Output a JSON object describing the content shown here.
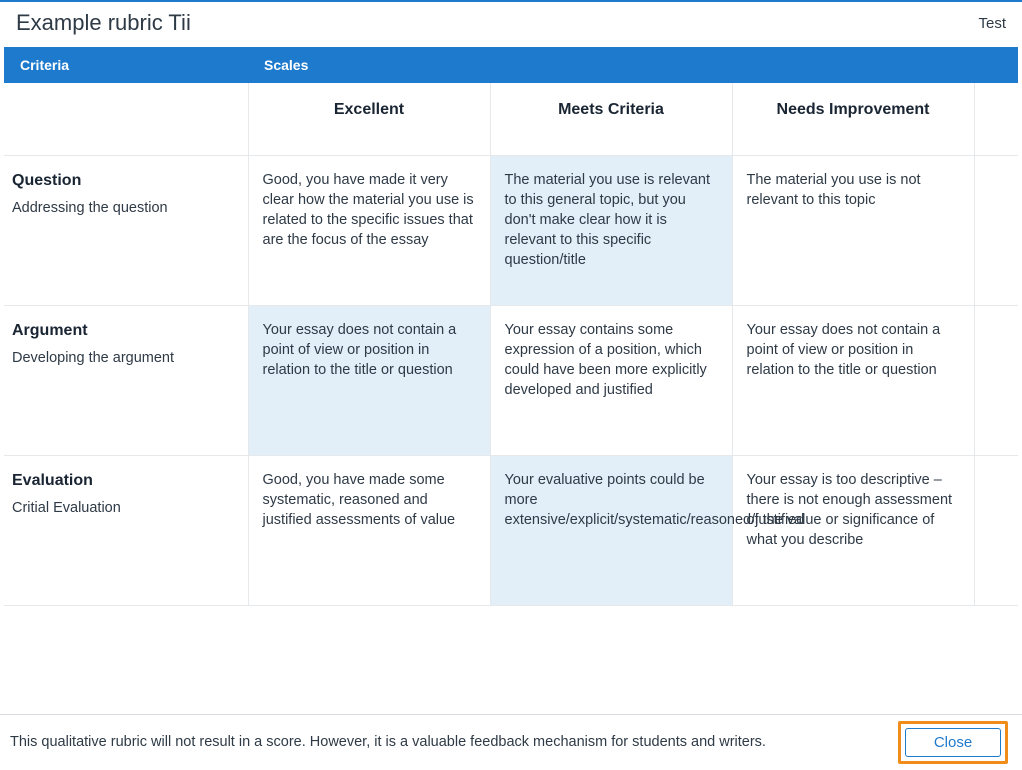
{
  "header": {
    "title": "Example rubric Tii",
    "right_label": "Test"
  },
  "tableHeaders": {
    "criteria": "Criteria",
    "scales": "Scales"
  },
  "scales": [
    "Excellent",
    "Meets Criteria",
    "Needs Improvement"
  ],
  "rows": [
    {
      "title": "Question",
      "desc": "Addressing the question",
      "cells": [
        "Good, you have made it very clear how the material you use is related to the specific issues that are the focus of the essay",
        "The material you use is relevant to this general topic, but you don't make clear how it is relevant to this specific question/title",
        "The material you use is not relevant to this topic"
      ],
      "selected": 1
    },
    {
      "title": "Argument",
      "desc": "Developing the argument",
      "cells": [
        "Your essay does not contain a point of view or position in relation to the title or question",
        "Your essay contains some expression of a position, which could have been more explicitly developed and justified",
        "Your essay does not contain a point of view or position in relation to the title or question"
      ],
      "selected": 0
    },
    {
      "title": "Evaluation",
      "desc": "Critial Evaluation",
      "cells": [
        "Good, you have made some systematic, reasoned and justified assessments of value",
        "Your evaluative points could be more extensive/explicit/systematic/reasoned/justified",
        "Your essay is too descriptive – there is not enough assessment of the value or significance of what you describe"
      ],
      "selected": 1
    }
  ],
  "footer": {
    "note": "This qualitative rubric will not result in a score. However, it is a valuable feedback mechanism for students and writers.",
    "close": "Close"
  }
}
